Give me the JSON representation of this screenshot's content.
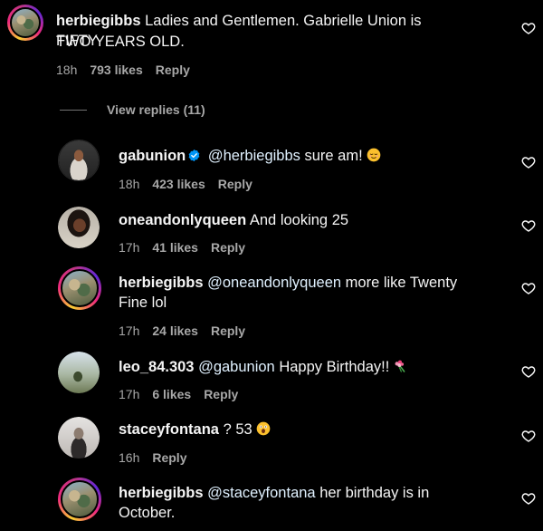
{
  "comments": [
    {
      "username": "herbiegibbs",
      "text_line1": "Ladies and Gentlemen. Gabrielle Union is FIFTY",
      "text_line2": "TWO YEARS OLD.",
      "time": "18h",
      "likes": "793 likes",
      "reply": "Reply"
    }
  ],
  "view_replies": "View replies (11)",
  "replies": [
    {
      "username": "gabunion",
      "verified": true,
      "mention": "@herbiegibbs",
      "text": "sure am!",
      "emoji": "relieved-face",
      "time": "18h",
      "likes": "423 likes",
      "reply": "Reply"
    },
    {
      "username": "oneandonlyqueen",
      "text": "And looking 25",
      "time": "17h",
      "likes": "41 likes",
      "reply": "Reply"
    },
    {
      "username": "herbiegibbs",
      "mention": "@oneandonlyqueen",
      "text": "more like Twenty",
      "text_line2": "Fine lol",
      "time": "17h",
      "likes": "24 likes",
      "reply": "Reply"
    },
    {
      "username": "leo_84.303",
      "mention": "@gabunion",
      "text": "Happy Birthday!!",
      "emoji": "bouquet",
      "time": "17h",
      "likes": "6 likes",
      "reply": "Reply"
    },
    {
      "username": "staceyfontana",
      "text": "? 53",
      "emoji": "astonished-face",
      "time": "16h",
      "reply": "Reply"
    },
    {
      "username": "herbiegibbs",
      "mention": "@staceyfontana",
      "text": "her birthday is in",
      "text_line2": "October."
    }
  ],
  "colors": {
    "background": "#000000",
    "text": "#f5f5f5",
    "secondary": "#a8a8a8",
    "mention": "#e0f1ff",
    "verified": "#0095f6"
  },
  "icons": {
    "like": "heart-outline-icon",
    "verified": "verified-badge-icon"
  }
}
